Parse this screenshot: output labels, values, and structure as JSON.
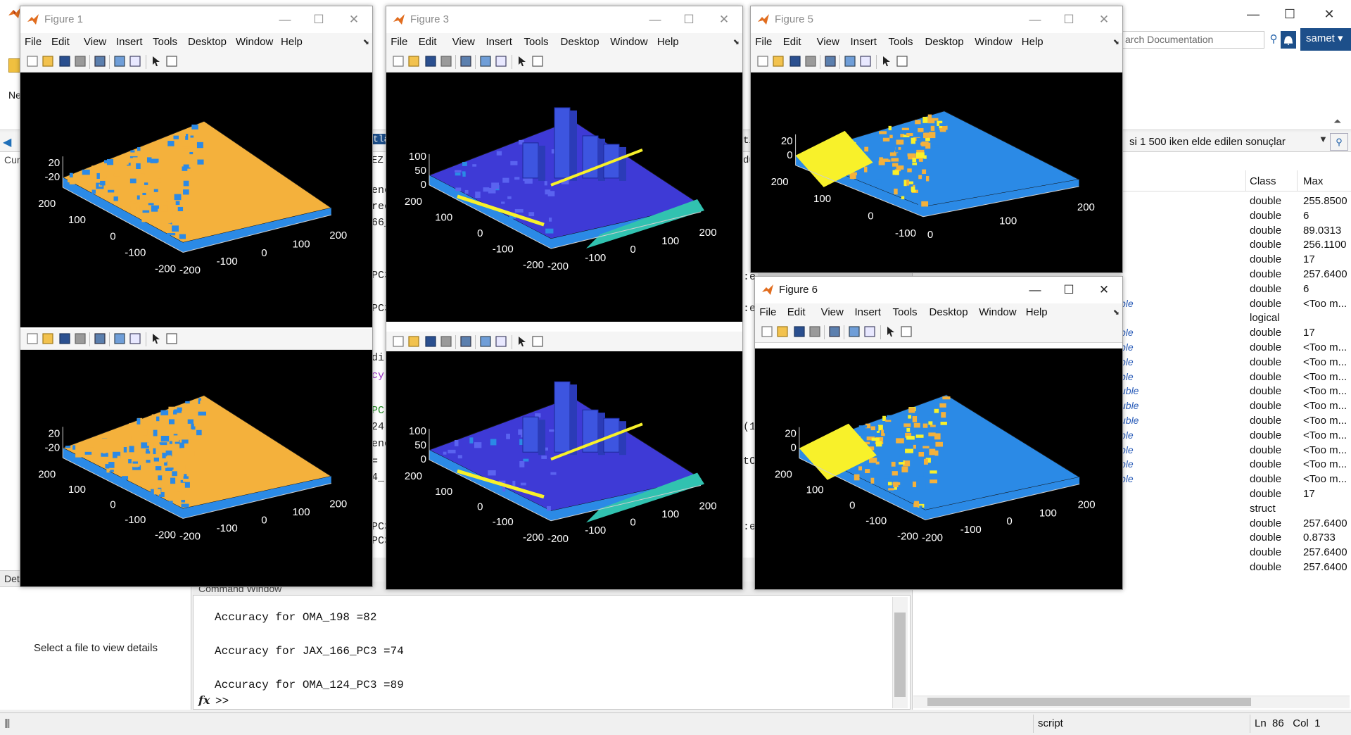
{
  "desktop": {
    "search_placeholder": "arch Documentation",
    "user": "samet",
    "path_text": "si  1 500 iken elde edilen sonuçlar",
    "left_tab": "Cur",
    "details_title": "Det",
    "details_msg": "Select a file to view details",
    "ribbon_frag": "Ne",
    "editor_frags": [
      "tlab",
      "EZ",
      "tit",
      "du"
    ],
    "code_frags": [
      "enc",
      "rec",
      "66_",
      "PC3",
      "PC3",
      "di",
      "cy",
      "PC",
      "24",
      "enc",
      "=",
      "4_",
      "PC3",
      "PC3",
      ":e",
      ":e",
      "(1",
      "tC",
      ":e"
    ]
  },
  "command_window": {
    "title": "Command Window",
    "lines": [
      "Accuracy for OMA_198 =82",
      "Accuracy for JAX_166_PC3 =74",
      "Accuracy for OMA_124_PC3 =89"
    ],
    "prompt": ">>"
  },
  "workspace": {
    "col_class": "Class",
    "col_max": "Max",
    "rows": [
      {
        "class": "double",
        "max": "255.8500"
      },
      {
        "class": "double",
        "max": "6"
      },
      {
        "class": "double",
        "max": "89.0313"
      },
      {
        "class": "double",
        "max": "256.1100"
      },
      {
        "class": "double",
        "max": "17"
      },
      {
        "class": "double",
        "max": "257.6400"
      },
      {
        "class": "double",
        "max": "6"
      },
      {
        "class": "double",
        "max": "<Too m..."
      },
      {
        "class": "logical",
        "max": ""
      },
      {
        "class": "double",
        "max": "17"
      },
      {
        "class": "double",
        "max": "<Too m..."
      },
      {
        "class": "double",
        "max": "<Too m..."
      },
      {
        "class": "double",
        "max": "<Too m..."
      },
      {
        "class": "double",
        "max": "<Too m..."
      },
      {
        "class": "double",
        "max": "<Too m..."
      },
      {
        "class": "double",
        "max": "<Too m..."
      },
      {
        "class": "double",
        "max": "<Too m..."
      },
      {
        "class": "double",
        "max": "<Too m..."
      },
      {
        "class": "double",
        "max": "<Too m..."
      },
      {
        "class": "double",
        "max": "<Too m..."
      },
      {
        "class": "double",
        "max": "17"
      },
      {
        "class": "struct",
        "max": ""
      },
      {
        "class": "double",
        "max": "257.6400"
      },
      {
        "class": "double",
        "max": "0.8733"
      },
      {
        "class": "double",
        "max": "257.6400"
      },
      {
        "class": "double",
        "max": "257.6400"
      }
    ],
    "type_frags": [
      "ble",
      "ble",
      "ble",
      "ble",
      "ble",
      "uble",
      "uble",
      "uble",
      "ble",
      "ble",
      "ble",
      "ble"
    ]
  },
  "status_bar": {
    "mode": "script",
    "ln_label": "Ln",
    "ln": "86",
    "col_label": "Col",
    "col": "1"
  },
  "figure_menu": [
    "File",
    "Edit",
    "View",
    "Insert",
    "Tools",
    "Desktop",
    "Window",
    "Help"
  ],
  "figures": {
    "fig1": {
      "title": "Figure 1",
      "top_plot": {
        "z_ticks": [
          "20",
          "-20"
        ],
        "y_ticks": [
          "200",
          "100",
          "0",
          "-100",
          "-200"
        ],
        "x_ticks": [
          "-200",
          "-100",
          "0",
          "100",
          "200"
        ]
      },
      "bottom_plot": {
        "z_ticks": [
          "20",
          "-20"
        ],
        "y_ticks": [
          "200",
          "100",
          "0",
          "-100",
          "-200"
        ],
        "x_ticks": [
          "-200",
          "-100",
          "0",
          "100",
          "200"
        ]
      }
    },
    "fig3": {
      "title": "Figure 3",
      "top_plot": {
        "z_ticks": [
          "100",
          "50",
          "0"
        ],
        "y_ticks": [
          "200",
          "100",
          "0",
          "-100",
          "-200"
        ],
        "x_ticks": [
          "-200",
          "-100",
          "0",
          "100",
          "200"
        ]
      },
      "bottom_plot": {
        "z_ticks": [
          "100",
          "50",
          "0"
        ],
        "y_ticks": [
          "200",
          "100",
          "0",
          "-100",
          "-200"
        ],
        "x_ticks": [
          "-200",
          "-100",
          "0",
          "100",
          "200"
        ]
      }
    },
    "fig5": {
      "title": "Figure 5",
      "plot": {
        "z_ticks": [
          "20",
          "0"
        ],
        "y_ticks": [
          "200",
          "100",
          "0",
          "-100"
        ],
        "x_ticks": [
          "0",
          "100",
          "200"
        ]
      }
    },
    "fig6": {
      "title": "Figure 6",
      "plot": {
        "z_ticks": [
          "20",
          "0"
        ],
        "y_ticks": [
          "200",
          "100",
          "0",
          "-100",
          "-200"
        ],
        "x_ticks": [
          "-200",
          "-100",
          "0",
          "100",
          "200"
        ]
      }
    }
  },
  "colors": {
    "orange": "#f4b13c",
    "yellow": "#f8f12a",
    "blue": "#2b8ae6",
    "indigo": "#3e3ad6",
    "teal": "#31c2b0",
    "titlebar_blue": "#1d4f8a"
  }
}
